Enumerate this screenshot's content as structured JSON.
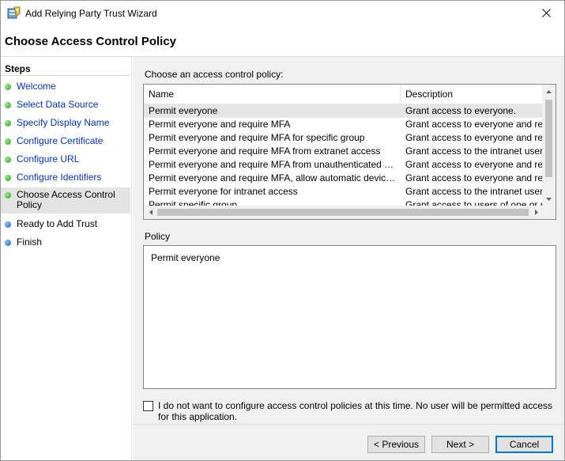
{
  "window": {
    "title": "Add Relying Party Trust Wizard",
    "page_title": "Choose Access Control Policy"
  },
  "steps": {
    "heading": "Steps",
    "items": [
      {
        "label": "Welcome",
        "state": "done"
      },
      {
        "label": "Select Data Source",
        "state": "done"
      },
      {
        "label": "Specify Display Name",
        "state": "done"
      },
      {
        "label": "Configure Certificate",
        "state": "done"
      },
      {
        "label": "Configure URL",
        "state": "done"
      },
      {
        "label": "Configure Identifiers",
        "state": "done"
      },
      {
        "label": "Choose Access Control Policy",
        "state": "current"
      },
      {
        "label": "Ready to Add Trust",
        "state": "todo"
      },
      {
        "label": "Finish",
        "state": "todo"
      }
    ]
  },
  "policy_list": {
    "label": "Choose an access control policy:",
    "columns": [
      "Name",
      "Description"
    ],
    "rows": [
      {
        "name": "Permit everyone",
        "description": "Grant access to everyone.",
        "selected": true
      },
      {
        "name": "Permit everyone and require MFA",
        "description": "Grant access to everyone and requir"
      },
      {
        "name": "Permit everyone and require MFA for specific group",
        "description": "Grant access to everyone and requir"
      },
      {
        "name": "Permit everyone and require MFA from extranet access",
        "description": "Grant access to the intranet users an"
      },
      {
        "name": "Permit everyone and require MFA from unauthenticated devices",
        "description": "Grant access to everyone and requir"
      },
      {
        "name": "Permit everyone and require MFA, allow automatic device registr...",
        "description": "Grant access to everyone and requir"
      },
      {
        "name": "Permit everyone for intranet access",
        "description": "Grant access to the intranet users."
      },
      {
        "name": "Permit specific group",
        "description": "Grant access to users of one or more"
      }
    ]
  },
  "policy_detail": {
    "label": "Policy",
    "text": "Permit everyone"
  },
  "opt_out": {
    "label": "I do not want to configure access control policies at this time. No user will be permitted access for this application.",
    "checked": false
  },
  "buttons": {
    "previous": "< Previous",
    "next": "Next >",
    "cancel": "Cancel"
  },
  "colors": {
    "link_blue": "#0033cc",
    "done_dot": "#2aa41a",
    "todo_dot": "#2060c8",
    "focus_border": "#0078d7"
  }
}
